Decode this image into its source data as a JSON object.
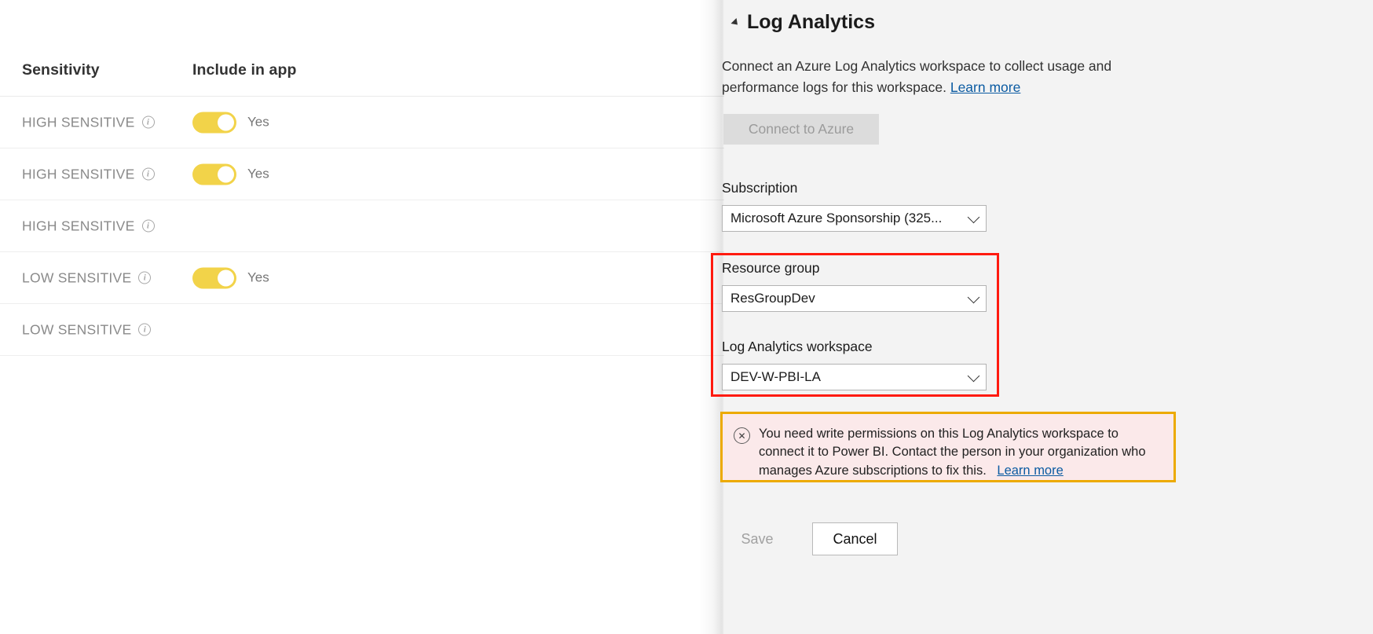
{
  "table": {
    "columns": [
      "Sensitivity",
      "Include in app"
    ],
    "rows": [
      {
        "sensitivity": "HIGH SENSITIVE",
        "info_icon": "info-icon",
        "toggle": true,
        "toggle_label": "Yes"
      },
      {
        "sensitivity": "HIGH SENSITIVE",
        "info_icon": "info-icon",
        "toggle": true,
        "toggle_label": "Yes"
      },
      {
        "sensitivity": "HIGH SENSITIVE",
        "info_icon": "info-icon",
        "toggle": false,
        "toggle_label": ""
      },
      {
        "sensitivity": "LOW SENSITIVE",
        "info_icon": "info-icon",
        "toggle": true,
        "toggle_label": "Yes"
      },
      {
        "sensitivity": "LOW SENSITIVE",
        "info_icon": "info-icon",
        "toggle": false,
        "toggle_label": ""
      }
    ]
  },
  "panel": {
    "title": "Log Analytics",
    "collapse_icon": "caret-down-icon",
    "description": "Connect an Azure Log Analytics workspace to collect usage and performance logs for this workspace.",
    "description_link": "Learn more",
    "connect_button": "Connect to Azure",
    "subscription": {
      "label": "Subscription",
      "value": "Microsoft Azure Sponsorship (325...",
      "chevron_icon": "chevron-down-icon"
    },
    "resource_group": {
      "label": "Resource group",
      "value": "ResGroupDev",
      "chevron_icon": "chevron-down-icon"
    },
    "log_analytics_workspace": {
      "label": "Log Analytics workspace",
      "value": "DEV-W-PBI-LA",
      "chevron_icon": "chevron-down-icon"
    },
    "error": {
      "icon": "error-circle-x-icon",
      "message": "You need write permissions on this Log Analytics workspace to connect it to Power BI. Contact the person in your organization who manages Azure subscriptions to fix this.",
      "link": "Learn more"
    },
    "footer": {
      "save_label": "Save",
      "cancel_label": "Cancel"
    }
  },
  "colors": {
    "panel_background": "#f3f3f3",
    "toggle_on": "#f2d349",
    "highlight_red": "#ff1a0f",
    "error_border": "#ecaa00",
    "error_background": "#fbe9ea",
    "link": "#0b5ba2"
  }
}
